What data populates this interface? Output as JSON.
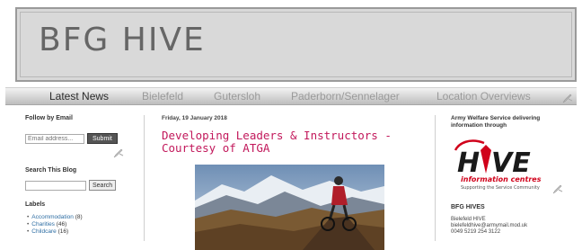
{
  "header": {
    "title": "BFG HIVE"
  },
  "nav": {
    "tabs": [
      {
        "label": "Latest News",
        "active": true
      },
      {
        "label": "Bielefeld",
        "active": false
      },
      {
        "label": "Gutersloh",
        "active": false
      },
      {
        "label": "Paderborn/Sennelager",
        "active": false
      },
      {
        "label": "Location Overviews",
        "active": false
      }
    ]
  },
  "sidebar_left": {
    "follow_title": "Follow by Email",
    "email_placeholder": "Email address...",
    "submit_label": "Submit",
    "search_title": "Search This Blog",
    "search_button": "Search",
    "labels_title": "Labels",
    "labels": [
      {
        "name": "Accommodation",
        "count": "(8)"
      },
      {
        "name": "Charities",
        "count": "(46)"
      },
      {
        "name": "Childcare",
        "count": "(16)"
      }
    ]
  },
  "post": {
    "date": "Friday, 19 January 2018",
    "title": "Developing Leaders & Instructors - Courtesy of ATGA"
  },
  "sidebar_right": {
    "aws_text": "Army Welfare Service delivering information through",
    "logo_word": "HIVE",
    "logo_subtitle": "information centres",
    "logo_tagline": "Supporting the Service Community",
    "bfg_title": "BFG HIVES",
    "contact": {
      "name": "Bielefeld HIVE",
      "email": "bielefeldhive@armymail.mod.uk",
      "phone": "0049 5219 254 3122"
    }
  },
  "colors": {
    "post_title": "#c2185b",
    "header_bg": "#d9d9d9",
    "logo_red": "#d0021b"
  }
}
